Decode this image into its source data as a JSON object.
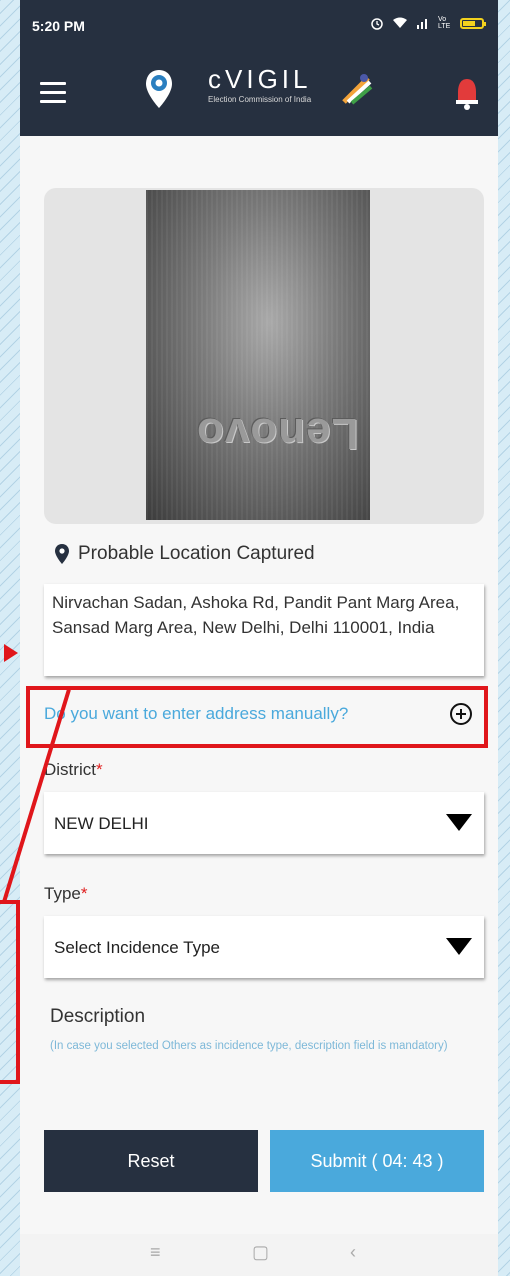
{
  "status_bar": {
    "time": "5:20 PM",
    "icons": [
      "alarm-icon",
      "wifi-icon",
      "signal-icon",
      "volte-icon",
      "battery-icon"
    ],
    "volte_text": "Vo LTE"
  },
  "app_bar": {
    "title": "cVIGIL",
    "subtitle": "Election Commission of India",
    "background": "#263040"
  },
  "photo": {
    "logo_text": "Lenovo"
  },
  "location": {
    "label": "Probable Location Captured",
    "address": "Nirvachan Sadan, Ashoka Rd, Pandit Pant Marg Area, Sansad Marg Area, New Delhi, Delhi 110001, India"
  },
  "manual_address": {
    "prompt": "Do you want to enter address manually?",
    "color": "#4aa9dc"
  },
  "district": {
    "label": "District",
    "required": "*",
    "value": "NEW DELHI"
  },
  "type": {
    "label": "Type",
    "required": "*",
    "placeholder": "Select Incidence Type"
  },
  "description": {
    "label": "Description",
    "note": "(In case you selected Others as incidence type, description field is mandatory)"
  },
  "buttons": {
    "reset_label": "Reset",
    "submit_label": "Submit ( 04: 43 )",
    "reset_color": "#263040",
    "submit_color": "#4aa9dc"
  },
  "nav_bar": {
    "menu_glyph": "≡",
    "home_glyph": "▢",
    "back_glyph": "‹"
  },
  "annotation_color": "#e0161b"
}
